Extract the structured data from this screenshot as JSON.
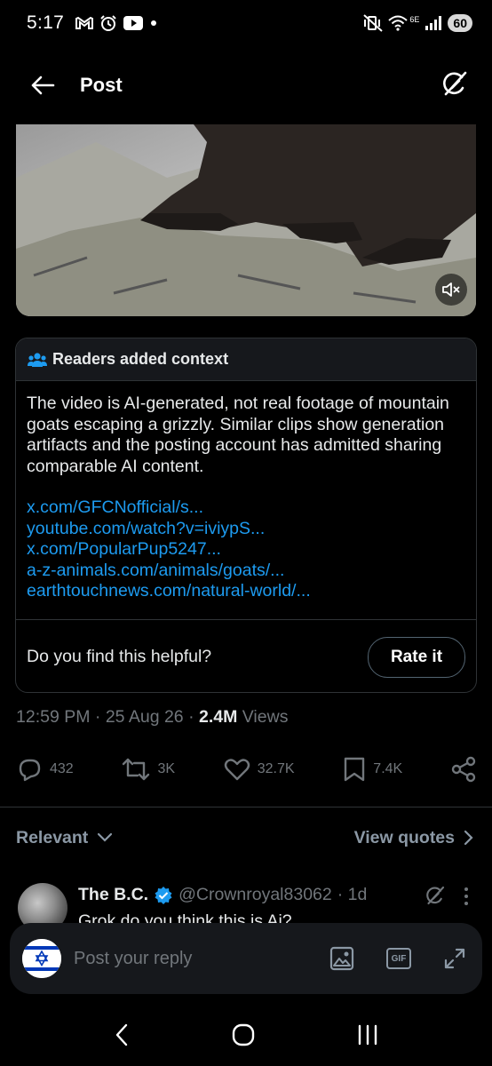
{
  "status_bar": {
    "time": "5:17",
    "network_label": "6E",
    "battery": "60"
  },
  "header": {
    "title": "Post"
  },
  "context": {
    "header_label": "Readers added context",
    "body": "The video is AI-generated, not real footage of mountain goats escaping a grizzly. Similar clips show generation artifacts and the posting account has admitted sharing comparable AI content.",
    "links": [
      "x.com/GFCNofficial/s...",
      "youtube.com/watch?v=iviypS...",
      "x.com/PopularPup5247...",
      "a-z-animals.com/animals/goats/...",
      "earthtouchnews.com/natural-world/..."
    ],
    "helpful_question": "Do you find this helpful?",
    "rate_label": "Rate it"
  },
  "meta": {
    "time": "12:59 PM",
    "date": "25 Aug 26",
    "views_count": "2.4M",
    "views_label": "Views",
    "sep": "·"
  },
  "actions": {
    "replies": "432",
    "reposts": "3K",
    "likes": "32.7K",
    "bookmarks": "7.4K"
  },
  "relevant": {
    "label": "Relevant",
    "view_quotes": "View quotes"
  },
  "reply": {
    "name": "The B.C.",
    "handle": "@Crownroyal83062",
    "time": "· 1d",
    "text": "Grok do you think this is Ai?"
  },
  "compose": {
    "placeholder": "Post your reply",
    "gif_label": "GIF"
  },
  "colors": {
    "accent": "#1d9bf0",
    "verified": "#1d9bf0",
    "muted": "#71767b"
  }
}
